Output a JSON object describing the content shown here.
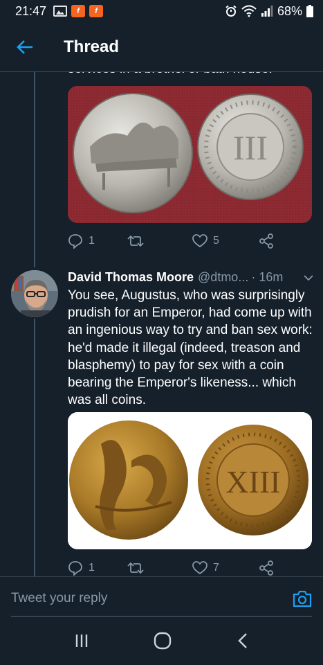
{
  "status_bar": {
    "time": "21:47",
    "battery": "68%"
  },
  "header": {
    "title": "Thread"
  },
  "tweet1": {
    "cut_text": "services in a brothel or bath house.",
    "replies": "1",
    "likes": "5"
  },
  "tweet2": {
    "author_name": "David Thomas Moore",
    "handle": "@dtmo...",
    "time": "· 16m",
    "text": "You see, Augustus, who was surprisingly prudish for an Emperor, had come up with an ingenious way to try and ban sex work: he'd made it illegal (indeed, treason and blasphemy) to pay for sex with a coin bearing the Emperor's likeness... which was all coins.",
    "coin_numeral": "XIII",
    "replies": "1",
    "likes": "7"
  },
  "tweet1_media": {
    "coin_numeral": "III"
  },
  "reply": {
    "placeholder": "Tweet your reply"
  },
  "colors": {
    "background": "#15202b",
    "accent": "#1da1f2",
    "muted": "#8899a6",
    "divider": "#38444d"
  },
  "icons": [
    "back-arrow-icon",
    "reply-icon",
    "retweet-icon",
    "like-icon",
    "share-icon",
    "camera-icon",
    "recents-icon",
    "home-icon",
    "nav-back-icon",
    "alarm-icon",
    "wifi-icon",
    "signal-icon",
    "battery-icon"
  ]
}
